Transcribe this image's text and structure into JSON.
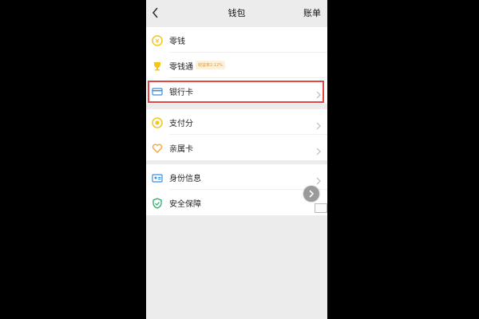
{
  "header": {
    "back_icon": "chevron-left-icon",
    "title": "钱包",
    "action_label": "账单"
  },
  "groups": [
    {
      "items": [
        {
          "label": "零钱",
          "icon": "coin-icon",
          "icon_color": "#f5c518"
        },
        {
          "label": "零钱通",
          "icon": "trophy-icon",
          "icon_color": "#f5c518",
          "badge": "收益率2.12%"
        },
        {
          "label": "银行卡",
          "icon": "bank-card-icon",
          "icon_color": "#3a8ee6",
          "highlighted": true
        }
      ]
    },
    {
      "items": [
        {
          "label": "支付分",
          "icon": "score-icon",
          "icon_color": "#f5c518"
        },
        {
          "label": "亲属卡",
          "icon": "family-card-icon",
          "icon_color": "#f2a93b"
        }
      ]
    },
    {
      "items": [
        {
          "label": "身份信息",
          "icon": "id-card-icon",
          "icon_color": "#3a8ee6"
        },
        {
          "label": "安全保障",
          "icon": "shield-icon",
          "icon_color": "#2aae67"
        }
      ]
    }
  ],
  "colors": {
    "highlight_border": "#e54545",
    "background": "#ececec"
  }
}
